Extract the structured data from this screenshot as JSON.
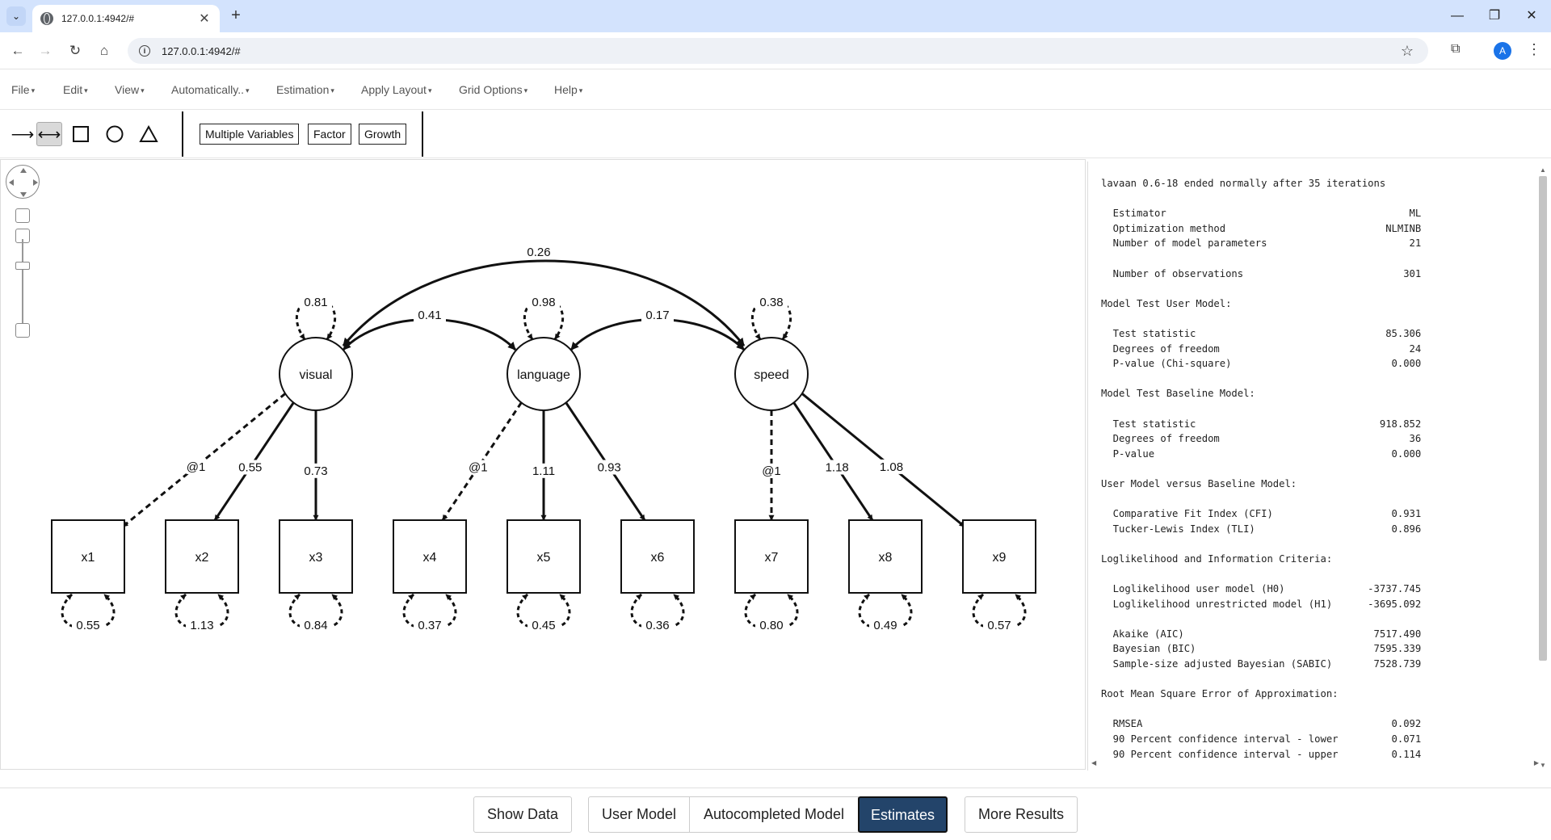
{
  "browser": {
    "tab_title": "127.0.0.1:4942/#",
    "url": "127.0.0.1:4942/#",
    "profile_initial": "A"
  },
  "menu": {
    "items": [
      "File",
      "Edit",
      "View",
      "Automatically..",
      "Estimation",
      "Apply Layout",
      "Grid Options",
      "Help"
    ]
  },
  "toolbar": {
    "buttons": [
      "Multiple Variables",
      "Factor",
      "Growth"
    ]
  },
  "diagram": {
    "latents": [
      {
        "name": "visual",
        "variance": "0.81"
      },
      {
        "name": "language",
        "variance": "0.98"
      },
      {
        "name": "speed",
        "variance": "0.38"
      }
    ],
    "covariances": [
      {
        "from": "visual",
        "to": "language",
        "value": "0.41"
      },
      {
        "from": "language",
        "to": "speed",
        "value": "0.17"
      },
      {
        "from": "visual",
        "to": "speed",
        "value": "0.26"
      }
    ],
    "observed": [
      {
        "name": "x1",
        "factor": "visual",
        "loading": "@1",
        "fixed": true,
        "residual": "0.55"
      },
      {
        "name": "x2",
        "factor": "visual",
        "loading": "0.55",
        "fixed": false,
        "residual": "1.13"
      },
      {
        "name": "x3",
        "factor": "visual",
        "loading": "0.73",
        "fixed": false,
        "residual": "0.84"
      },
      {
        "name": "x4",
        "factor": "language",
        "loading": "@1",
        "fixed": true,
        "residual": "0.37"
      },
      {
        "name": "x5",
        "factor": "language",
        "loading": "1.11",
        "fixed": false,
        "residual": "0.45"
      },
      {
        "name": "x6",
        "factor": "language",
        "loading": "0.93",
        "fixed": false,
        "residual": "0.36"
      },
      {
        "name": "x7",
        "factor": "speed",
        "loading": "@1",
        "fixed": true,
        "residual": "0.80"
      },
      {
        "name": "x8",
        "factor": "speed",
        "loading": "1.18",
        "fixed": false,
        "residual": "0.49"
      },
      {
        "name": "x9",
        "factor": "speed",
        "loading": "1.08",
        "fixed": false,
        "residual": "0.57"
      }
    ]
  },
  "output": {
    "lines": [
      "lavaan 0.6-18 ended normally after 35 iterations",
      "",
      "  Estimator                                         ML",
      "  Optimization method                           NLMINB",
      "  Number of model parameters                        21",
      "",
      "  Number of observations                           301",
      "",
      "Model Test User Model:",
      "",
      "  Test statistic                                85.306",
      "  Degrees of freedom                                24",
      "  P-value (Chi-square)                           0.000",
      "",
      "Model Test Baseline Model:",
      "",
      "  Test statistic                               918.852",
      "  Degrees of freedom                                36",
      "  P-value                                        0.000",
      "",
      "User Model versus Baseline Model:",
      "",
      "  Comparative Fit Index (CFI)                    0.931",
      "  Tucker-Lewis Index (TLI)                       0.896",
      "",
      "Loglikelihood and Information Criteria:",
      "",
      "  Loglikelihood user model (H0)              -3737.745",
      "  Loglikelihood unrestricted model (H1)      -3695.092",
      "",
      "  Akaike (AIC)                                7517.490",
      "  Bayesian (BIC)                              7595.339",
      "  Sample-size adjusted Bayesian (SABIC)       7528.739",
      "",
      "Root Mean Square Error of Approximation:",
      "",
      "  RMSEA                                          0.092",
      "  90 Percent confidence interval - lower         0.071",
      "  90 Percent confidence interval - upper         0.114"
    ]
  },
  "bottom": {
    "show_data": "Show Data",
    "tabs": [
      "User Model",
      "Autocompleted Model",
      "Estimates"
    ],
    "active_tab": "Estimates",
    "more_results": "More Results"
  },
  "colors": {
    "active_tab_bg": "#23446a",
    "tab_strip": "#d3e3fd"
  },
  "icons": [
    "tab-list-icon",
    "globe-icon",
    "close-icon",
    "plus-icon",
    "minimize-icon",
    "restore-icon",
    "back-icon",
    "forward-icon",
    "reload-icon",
    "home-icon",
    "info-icon",
    "star-icon",
    "extensions-icon",
    "kebab-icon",
    "arrow-tool-icon",
    "double-arrow-tool-icon",
    "square-tool-icon",
    "circle-tool-icon",
    "triangle-tool-icon"
  ]
}
